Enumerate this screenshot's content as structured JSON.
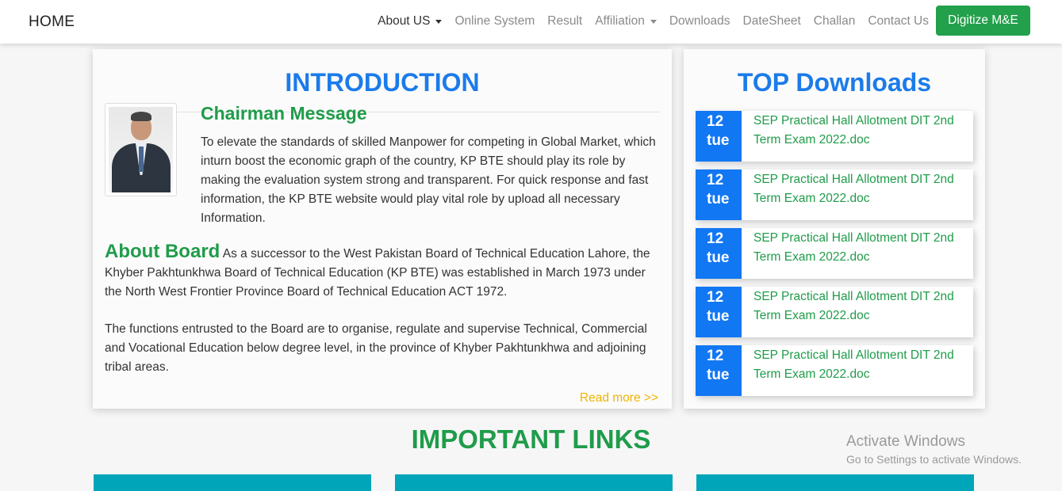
{
  "navbar": {
    "brand": "HOME",
    "links": [
      {
        "label": "About US",
        "has_dropdown": true,
        "active": true
      },
      {
        "label": "Online System",
        "has_dropdown": false
      },
      {
        "label": "Result",
        "has_dropdown": false
      },
      {
        "label": "Affiliation",
        "has_dropdown": true
      },
      {
        "label": "Downloads",
        "has_dropdown": false
      },
      {
        "label": "DateSheet",
        "has_dropdown": false
      },
      {
        "label": "Challan",
        "has_dropdown": false
      },
      {
        "label": "Contact Us",
        "has_dropdown": false
      }
    ],
    "cta_label": "Digitize M&E"
  },
  "intro": {
    "title": "INTRODUCTION",
    "chairman_title": "Chairman Message",
    "chairman_text": "To elevate the standards of skilled Manpower for competing in Global Market, which inturn boost the economic graph of the country, KP BTE should play its role by making the evaluation system strong and transparent. For quick response and fast information, the KP BTE website would play vital role by upload all necessary Information.",
    "about_title": "About Board",
    "about_text": "As a successor to the West Pakistan Board of Technical Education Lahore, the Khyber Pakhtunkhwa Board of Technical Education (KP BTE) was established in March 1973 under the North West Frontier Province Board of Technical Education ACT 1972.",
    "functions_text": "The functions entrusted to the Board are to organise, regulate and supervise Technical, Commercial and Vocational Education below degree level, in the province of Khyber Pakhtunkhwa and adjoining tribal areas.",
    "read_more": "Read more >>"
  },
  "downloads": {
    "title": "TOP Downloads",
    "items": [
      {
        "day": "12",
        "weekday": "tue",
        "title": "SEP Practical Hall Allotment DIT 2nd Term Exam 2022.doc"
      },
      {
        "day": "12",
        "weekday": "tue",
        "title": "SEP Practical Hall Allotment DIT 2nd Term Exam 2022.doc"
      },
      {
        "day": "12",
        "weekday": "tue",
        "title": "SEP Practical Hall Allotment DIT 2nd Term Exam 2022.doc"
      },
      {
        "day": "12",
        "weekday": "tue",
        "title": "SEP Practical Hall Allotment DIT 2nd Term Exam 2022.doc"
      },
      {
        "day": "12",
        "weekday": "tue",
        "title": "SEP Practical Hall Allotment DIT 2nd Term Exam 2022.doc"
      }
    ]
  },
  "important_links": {
    "title": "IMPORTANT LINKS"
  },
  "watermark": {
    "title": "Activate Windows",
    "subtitle": "Go to Settings to activate Windows."
  },
  "colors": {
    "green": "#1f9c4a",
    "blue": "#1b7bea",
    "date_blue": "#1177f3",
    "teal": "#00a5b9",
    "gold": "#f0b400"
  }
}
